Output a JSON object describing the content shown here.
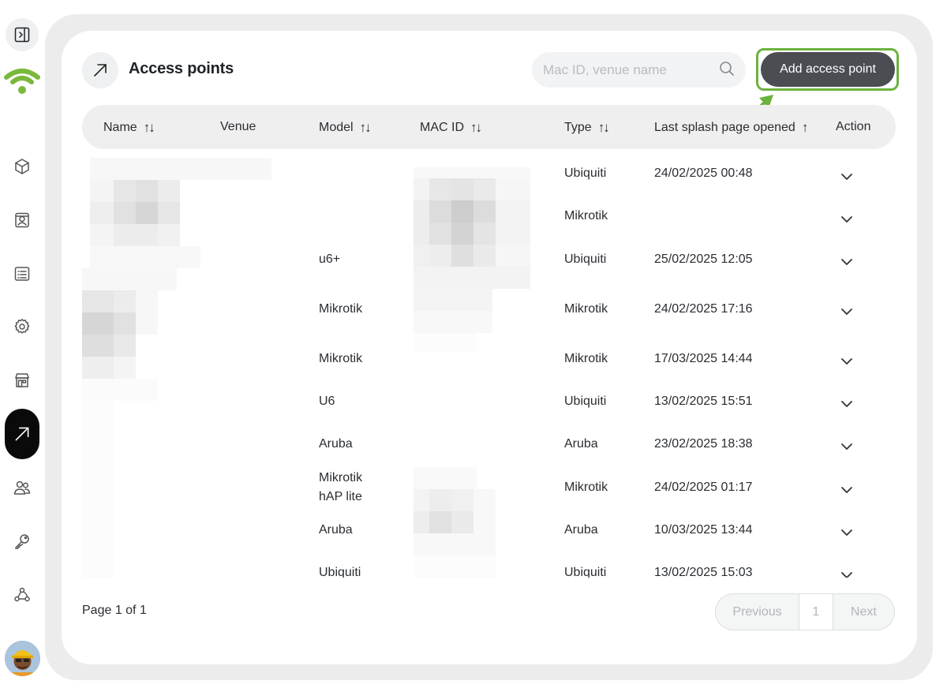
{
  "header": {
    "title": "Access points",
    "search_placeholder": "Mac ID, venue name",
    "add_button": "Add access point"
  },
  "sidebar": {
    "items": [
      "collapse-sidebar",
      "wifi-logo",
      "box",
      "contacts",
      "reports",
      "settings",
      "store",
      "access-points",
      "users",
      "keys",
      "integrations",
      "avatar"
    ],
    "active": "access-points",
    "brand_color": "#6cb23d"
  },
  "table": {
    "columns": [
      {
        "label": "Name",
        "sortable": true
      },
      {
        "label": "Venue",
        "sortable": false
      },
      {
        "label": "Model",
        "sortable": true
      },
      {
        "label": "MAC ID",
        "sortable": true
      },
      {
        "label": "Type",
        "sortable": true
      },
      {
        "label": "Last splash page opened",
        "sortable": true,
        "sort_dir": "asc"
      },
      {
        "label": "Action",
        "sortable": false
      }
    ],
    "rows": [
      {
        "model": "",
        "type": "Ubiquiti",
        "last": "24/02/2025 00:48"
      },
      {
        "model": "",
        "type": "Mikrotik",
        "last": ""
      },
      {
        "model": "u6+",
        "type": "Ubiquiti",
        "last": "25/02/2025 12:05"
      },
      {
        "model": "Mikrotik",
        "type": "Mikrotik",
        "last": "24/02/2025 17:16"
      },
      {
        "model": "Mikrotik",
        "type": "Mikrotik",
        "last": "17/03/2025 14:44"
      },
      {
        "model": "U6",
        "type": "Ubiquiti",
        "last": "13/02/2025 15:51"
      },
      {
        "model": "Aruba",
        "type": "Aruba",
        "last": "23/02/2025 18:38"
      },
      {
        "model": "Mikrotik\nhAP lite",
        "type": "Mikrotik",
        "last": "24/02/2025 01:17"
      },
      {
        "model": "Aruba",
        "type": "Aruba",
        "last": "10/03/2025 13:44"
      },
      {
        "model": "Ubiquiti",
        "type": "Ubiquiti",
        "last": "13/02/2025 15:03"
      }
    ]
  },
  "footer": {
    "page_info": "Page 1 of 1",
    "previous": "Previous",
    "current_page": "1",
    "next": "Next"
  }
}
